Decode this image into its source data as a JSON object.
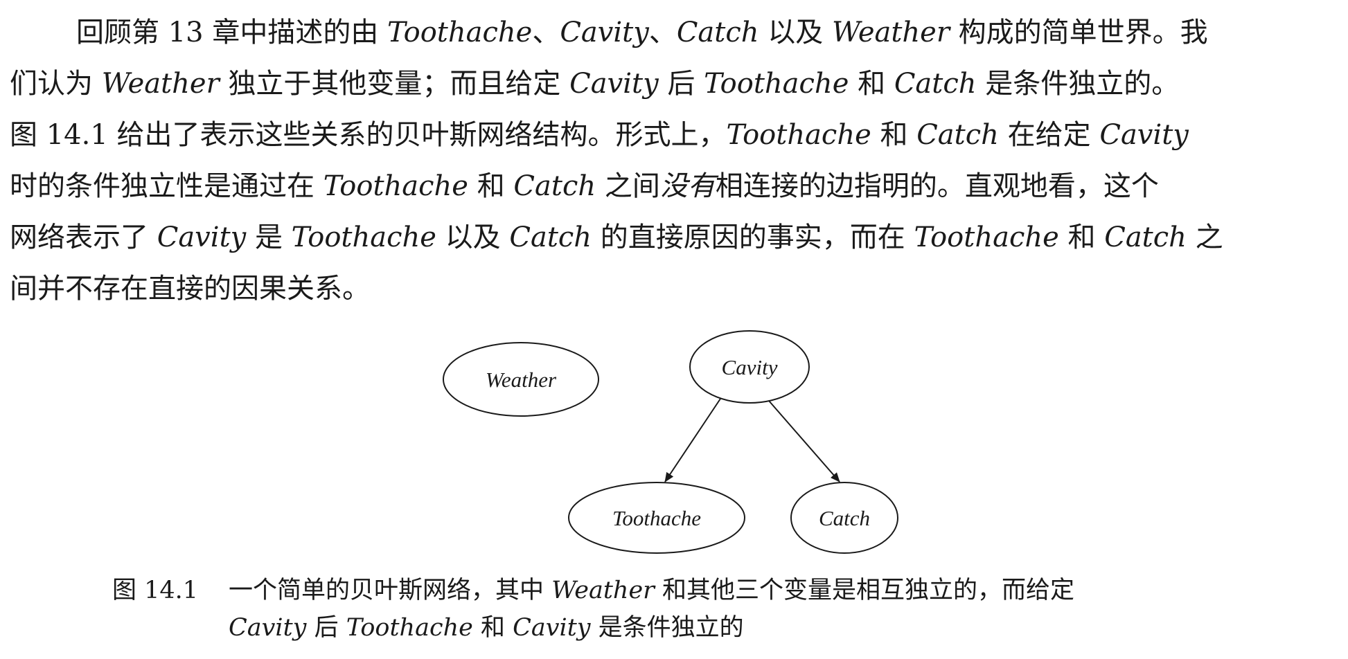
{
  "paragraph": {
    "lines": [
      [
        "回顾第 13 章中描述的由 ",
        {
          "i": "Toothache"
        },
        "、",
        {
          "i": "Cavity"
        },
        "、",
        {
          "i": "Catch"
        },
        " 以及 ",
        {
          "i": "Weather"
        },
        " 构成的简单世界。我"
      ],
      [
        "们认为 ",
        {
          "i": "Weather"
        },
        " 独立于其他变量；而且给定 ",
        {
          "i": "Cavity"
        },
        " 后 ",
        {
          "i": "Toothache"
        },
        " 和 ",
        {
          "i": "Catch"
        },
        " 是条件独立的。"
      ],
      [
        "图 14.1 给出了表示这些关系的贝叶斯网络结构。形式上，",
        {
          "i": "Toothache"
        },
        " 和 ",
        {
          "i": "Catch"
        },
        " 在给定 ",
        {
          "i": "Cavity"
        }
      ],
      [
        "时的条件独立性是通过在 ",
        {
          "i": "Toothache"
        },
        " 和 ",
        {
          "i": "Catch"
        },
        " 之间",
        {
          "i": "没有"
        },
        "相连接的边指明的。直观地看，这个"
      ],
      [
        "网络表示了 ",
        {
          "i": "Cavity"
        },
        " 是 ",
        {
          "i": "Toothache"
        },
        " 以及 ",
        {
          "i": "Catch"
        },
        " 的直接原因的事实，而在 ",
        {
          "i": "Toothache"
        },
        " 和 ",
        {
          "i": "Catch"
        },
        " 之"
      ],
      [
        "间并不存在直接的因果关系。"
      ]
    ]
  },
  "figure": {
    "nodes": {
      "weather": "Weather",
      "cavity": "Cavity",
      "toothache": "Toothache",
      "catch": "Catch"
    },
    "edges": [
      [
        "Cavity",
        "Toothache"
      ],
      [
        "Cavity",
        "Catch"
      ]
    ]
  },
  "caption": {
    "label": "图  14.1",
    "line1": [
      "一个简单的贝叶斯网络，其中 ",
      {
        "i": "Weather"
      },
      " 和其他三个变量是相互独立的，而给定"
    ],
    "line2": [
      {
        "i": "Cavity"
      },
      " 后 ",
      {
        "i": "Toothache"
      },
      " 和 ",
      {
        "i": "Cavity"
      },
      " 是条件独立的"
    ]
  }
}
